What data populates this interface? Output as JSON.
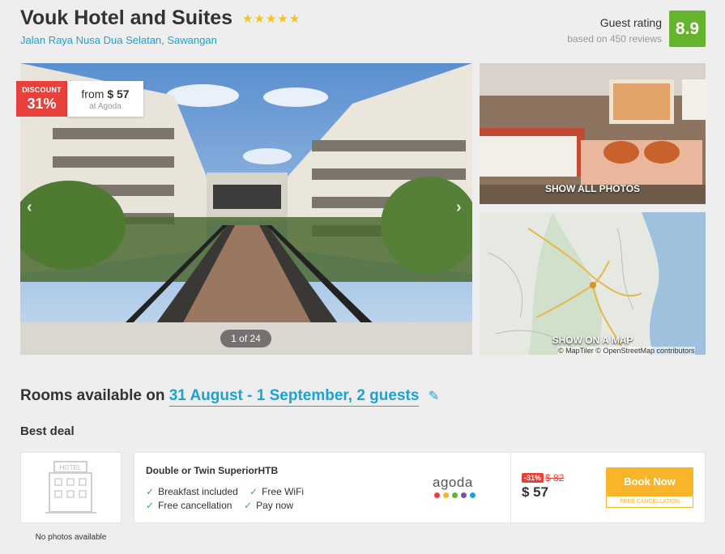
{
  "hotel": {
    "name": "Vouk Hotel and Suites",
    "star_rating": 5,
    "address": "Jalan Raya Nusa Dua Selatan, Sawangan"
  },
  "rating": {
    "label": "Guest rating",
    "reviews": "based on 450 reviews",
    "score": "8.9"
  },
  "gallery": {
    "discount_label": "DISCOUNT",
    "discount_value": "31%",
    "from_prefix": "from",
    "from_price": "$ 57",
    "from_source": "at Agoda",
    "counter": "1 of 24",
    "show_all_photos": "SHOW ALL PHOTOS",
    "show_on_map": "SHOW ON A MAP",
    "map_credit": "© MapTiler © OpenStreetMap contributors"
  },
  "rooms": {
    "heading": "Rooms available on",
    "dates": "31 August - 1 September, 2 guests",
    "best_deal": "Best deal",
    "no_photos": "No photos available"
  },
  "deal": {
    "room_name": "Double or Twin SuperiorHTB",
    "features": [
      "Breakfast included",
      "Free WiFi",
      "Free cancellation",
      "Pay now"
    ],
    "provider": "agoda",
    "discount_badge": "-31%",
    "old_price": "$ 82",
    "price": "$ 57",
    "book_label": "Book Now",
    "cancel_note": "FREE CANCELLATION"
  },
  "colors": {
    "accent_link": "#1aa3d6",
    "rating_green": "#66b32e",
    "discount_red": "#e8403a",
    "book_orange": "#f8b52a",
    "agoda_dots": [
      "#e8403a",
      "#f8b52a",
      "#66b32e",
      "#7b4ea3",
      "#1aa3d6"
    ]
  },
  "icons": [
    "star-icon",
    "chevron-left-icon",
    "chevron-right-icon",
    "pencil-icon",
    "check-icon",
    "hotel-building-icon"
  ]
}
